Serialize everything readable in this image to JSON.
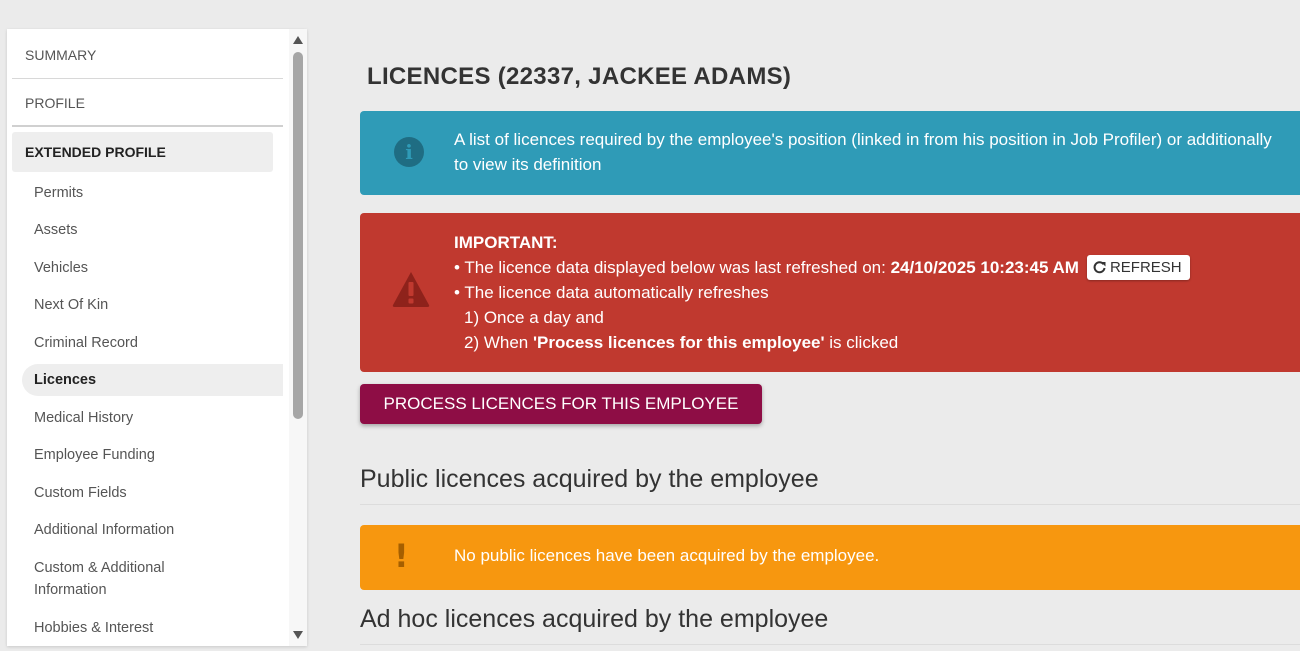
{
  "sidebar": {
    "top_items": [
      "SUMMARY",
      "PROFILE"
    ],
    "active_section": "EXTENDED PROFILE",
    "sub_items": [
      "Permits",
      "Assets",
      "Vehicles",
      "Next Of Kin",
      "Criminal Record",
      "Licences",
      "Medical History",
      "Employee Funding",
      "Custom Fields",
      "Additional Information",
      "Custom & Additional\nInformation",
      "Hobbies & Interest"
    ],
    "selected_item": "Licences"
  },
  "main": {
    "title": "LICENCES (22337, JACKEE ADAMS)",
    "info_alert": {
      "line1": "A list of licences required by the employee's position (linked in from his position in Job Profiler) or additionally",
      "line2": "to view its definition"
    },
    "important_alert": {
      "heading": "IMPORTANT:",
      "line1_prefix": "• The licence data displayed below was last refreshed on: ",
      "refreshed_at": "24/10/2025 10:23:45 AM",
      "refresh_label": "REFRESH",
      "line2": "•  The licence data automatically refreshes",
      "line3": "1) Once a day and",
      "line4_prefix": "2) When ",
      "line4_bold": "'Process licences for this employee'",
      "line4_suffix": " is clicked"
    },
    "process_button": "PROCESS LICENCES FOR THIS EMPLOYEE",
    "public_heading": "Public licences acquired by the employee",
    "public_empty": "No public licences have been acquired by the employee.",
    "adhoc_heading": "Ad hoc licences acquired by the employee"
  },
  "colors": {
    "info": "#2f9bb7",
    "danger": "#c0392f",
    "warning": "#f7970f",
    "primary_button": "#8e0d45"
  },
  "icons": {
    "info": "info-circle-icon",
    "danger": "warning-triangle-icon",
    "refresh": "refresh-icon",
    "warning": "exclamation-icon"
  }
}
